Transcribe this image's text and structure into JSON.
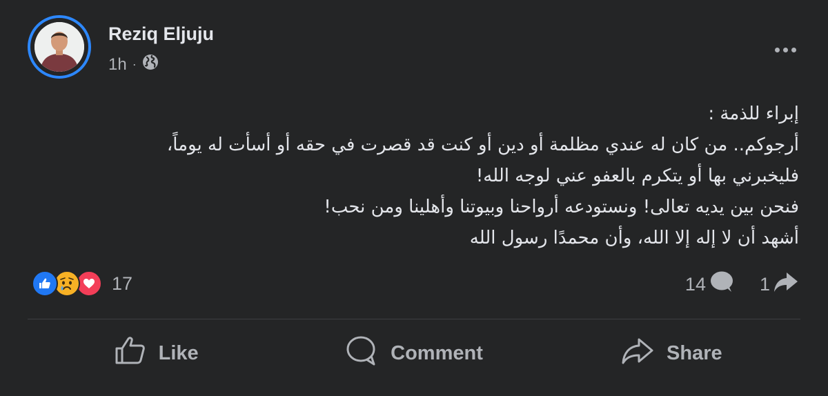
{
  "post": {
    "author": "Reziq Eljuju",
    "time": "1h",
    "separator": "·",
    "visibility_icon": "globe-icon",
    "body_lines": [
      "إبراء للذمة :",
      "أرجوكم.. من كان له عندي مظلمة أو دين أو كنت قد قصرت في حقه أو أسأت له يوماً،",
      "فليخبرني بها أو يتكرم بالعفو عني لوجه الله!",
      "فنحن بين يديه تعالى! ونستودعه أرواحنا وبيوتنا وأهلينا ومن نحب!",
      "أشهد أن لا إله إلا الله، وأن محمدًا رسول الله"
    ]
  },
  "reactions": {
    "icons": [
      "like-icon",
      "sad-icon",
      "love-icon"
    ],
    "count": "17"
  },
  "stats": {
    "comments": "14",
    "shares": "1"
  },
  "actions": {
    "like": "Like",
    "comment": "Comment",
    "share": "Share"
  },
  "colors": {
    "background": "#242526",
    "text": "#e4e6eb",
    "muted": "#b0b3b8",
    "accent": "#2d88ff",
    "like": "#2078f4",
    "sad": "#f7b125",
    "love": "#f33e58"
  }
}
